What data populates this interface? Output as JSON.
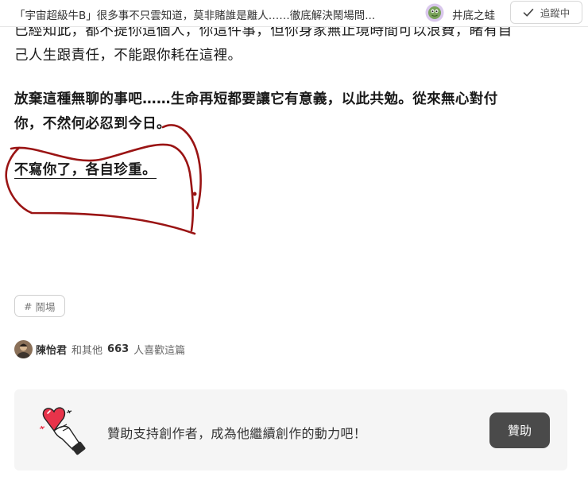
{
  "header": {
    "article_title": "「宇宙超級牛B」很多事不只雲知道，莫非賭誰是離人……徹底解決鬧場問...",
    "author_name": "井底之蛙",
    "follow_label": "追蹤中"
  },
  "article": {
    "cut_line_1": "已經知此，都不提你這個人，你這件事，但你身家無止境時間可以浪費，睹有自",
    "line_1": "己人生跟責任，不能跟你耗在這裡。",
    "line_2": "放棄這種無聊的事吧……生命再短都要讓它有意義，以此共勉。從來無心對付",
    "line_3": "你，不然何必忍到今日。",
    "line_4": "不寫你了，各自珍重。"
  },
  "tag": {
    "hash": "#",
    "label": "鬧場"
  },
  "likes": {
    "name": "陳怡君",
    "prefix": "和其他",
    "count": "663",
    "suffix": "人喜歡這篇"
  },
  "support": {
    "text": "贊助支持創作者，成為他繼續創作的動力吧！",
    "button_label": "贊助"
  },
  "colors": {
    "scribble": "#9a1414",
    "button_dark": "#4a4a4a",
    "support_bg": "#f5f5f5",
    "heart": "#e8334a"
  }
}
